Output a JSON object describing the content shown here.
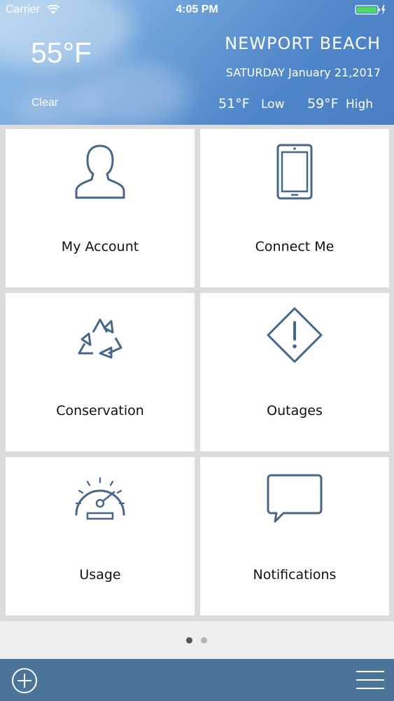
{
  "status_bar": {
    "carrier": "Carrier",
    "time": "4:05 PM",
    "wifi_icon": "wifi-icon",
    "battery_icon": "battery-charging-icon"
  },
  "weather": {
    "temperature": "55°F",
    "condition": "Clear",
    "city": "NEWPORT BEACH",
    "date": "SATURDAY January 21,2017",
    "low_value": "51°F",
    "low_label": "Low",
    "high_value": "59°F",
    "high_label": "High"
  },
  "tiles": [
    {
      "label": "My Account",
      "icon": "user-icon"
    },
    {
      "label": "Connect Me",
      "icon": "phone-icon"
    },
    {
      "label": "Conservation",
      "icon": "recycle-icon"
    },
    {
      "label": "Outages",
      "icon": "warning-icon"
    },
    {
      "label": "Usage",
      "icon": "gauge-icon"
    },
    {
      "label": "Notifications",
      "icon": "chat-bubble-icon"
    }
  ],
  "pager": {
    "current_page": 1,
    "total_pages": 2
  },
  "bottom_bar": {
    "add_icon": "plus-circle-icon",
    "menu_icon": "hamburger-menu-icon"
  },
  "colors": {
    "header_blue": "#5a8fcf",
    "icon_stroke": "#46668a",
    "bottom_bar": "#4b7599",
    "dot_active": "#555555",
    "dot_inactive": "#b4b4b4"
  }
}
